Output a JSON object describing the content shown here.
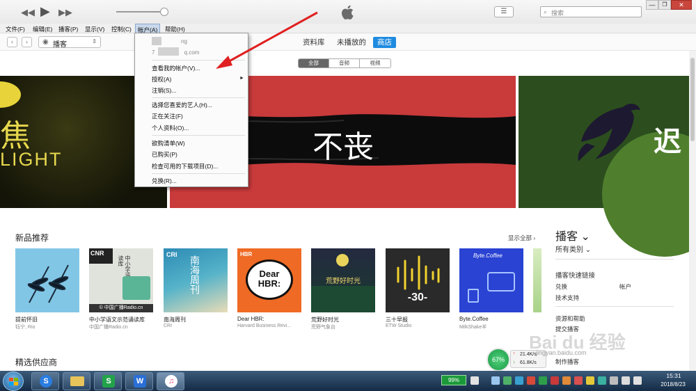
{
  "window": {
    "search_placeholder": "搜索"
  },
  "menubar": [
    "文件(F)",
    "编辑(E)",
    "播客(P)",
    "显示(V)",
    "控制(C)",
    "帐户(A)",
    "帮助(H)"
  ],
  "nav": {
    "source_select": "播客",
    "top_tabs": [
      "资料库",
      "未播放的",
      "商店"
    ],
    "segments": [
      "全部",
      "音频",
      "视频"
    ]
  },
  "banners": {
    "left_text_1": "焦",
    "left_text_2": "LIGHT",
    "mid_text": "不丧",
    "right_text": "迟"
  },
  "new_section": {
    "title": "新品推荐",
    "see_all": "显示全部 ›",
    "items": [
      {
        "name": "提前怀旧",
        "sub": "钰宁, Rio"
      },
      {
        "name": "中小学语文示范诵读库",
        "sub": "中国广播Radio.cn"
      },
      {
        "name": "南海周刊",
        "sub": "CRI"
      },
      {
        "name": "Dear HBR:",
        "sub": "Harvard Business Revi..."
      },
      {
        "name": "荒野好时光",
        "sub": "荒野气象台"
      },
      {
        "name": "三十早报",
        "sub": "ETW Studio"
      },
      {
        "name": "Byte.Coffee",
        "sub": "MilkShake羊"
      }
    ],
    "tile_texts": {
      "cnr_logo": "CNR",
      "cnr_title": "中小学语文示范诵读库",
      "cnr_caption": "© 中国广播Radio.cn",
      "cri_logo": "CRI",
      "cri_title": "南海周刊",
      "hbr_logo": "HBR",
      "hbr_bubble": "Dear HBR:",
      "wild_title": "荒野好时光",
      "thirty_text": "-30-",
      "byte_text": "Byte.Coffee"
    }
  },
  "featured_section": {
    "title": "精选供应商"
  },
  "sidebar": {
    "title": "播客 ⌄",
    "category": "所有类别 ⌄",
    "quick_links": "播客快速链接",
    "redeem": "兑换",
    "account": "帐户",
    "support": "技术支持",
    "help": "资源和帮助",
    "submit": "提交播客",
    "make": "制作播客"
  },
  "account_menu": {
    "email_1": "ng",
    "email_2": "7 q.com",
    "items": [
      {
        "label": "查看我的帐户(V)..."
      },
      {
        "label": "授权(A)",
        "arrow": "►"
      },
      {
        "label": "注销(S)..."
      },
      {
        "label": "选择您喜爱的艺人(H)..."
      },
      {
        "label": "正在关注(F)"
      },
      {
        "label": "个人资料(O)..."
      },
      {
        "label": "欲购清单(W)"
      },
      {
        "label": "已购买(P)"
      },
      {
        "label": "检查可用的下载项目(D)..."
      },
      {
        "label": "兑换(R)..."
      }
    ]
  },
  "overlay": {
    "net_percent": "67%",
    "up_speed": "21.4K/s",
    "down_speed": "61.8K/s"
  },
  "taskbar": {
    "battery": "99%",
    "time": "15:31",
    "date": "2018/8/23",
    "start_icon": "windows-orb-icon"
  },
  "watermark": {
    "text1": "Bai du 经验",
    "text2": "jingyan.baidu.com"
  },
  "colors": {
    "accent": "#1f8be0",
    "banner_red": "#c93a3b",
    "banner_green": "#2c4e1e",
    "arrow_red": "#e02020"
  }
}
